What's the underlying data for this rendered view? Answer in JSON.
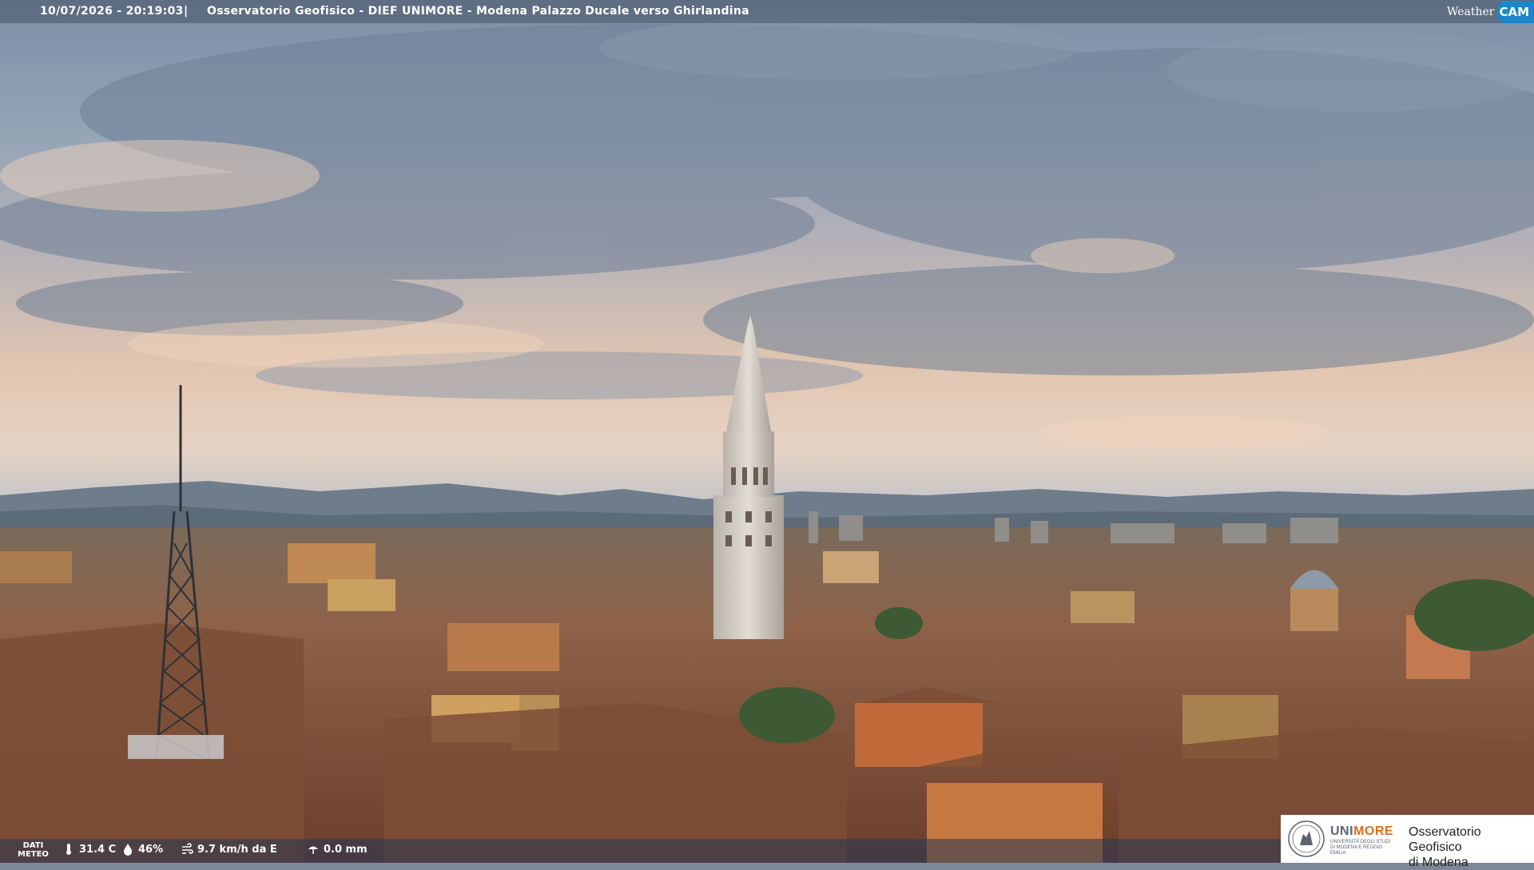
{
  "header": {
    "datetime": "10/07/2026 - 20:19:03",
    "separator": "|",
    "caption": "Osservatorio Geofisico - DIEF UNIMORE - Modena Palazzo Ducale verso Ghirlandina",
    "brand_weather": "Weather",
    "brand_cam": "CAM"
  },
  "weather": {
    "label_line1": "DATI",
    "label_line2": "METEO",
    "temperature": "31.4 C",
    "humidity": "46%",
    "wind": "9.7 km/h da E",
    "rain": "0.0 mm",
    "icons": [
      "thermometer-icon",
      "humidity-drop-icon",
      "wind-icon",
      "rain-gauge-icon"
    ]
  },
  "logo": {
    "uni": "UNI",
    "more": "MORE",
    "university_sub": "UNIVERSITÀ DEGLI STUDI DI MODENA E REGGIO EMILIA",
    "observatory_line1": "Osservatorio Geofisico",
    "observatory_line2": "di Modena",
    "colors": {
      "accent": "#d8701c",
      "text": "#5b6470"
    }
  },
  "colors": {
    "sky_top": "#8d9db2",
    "sky_glow": "#e8c8a8",
    "roofs": "#8a5a3e",
    "tower_stone": "#d9d3c8"
  }
}
